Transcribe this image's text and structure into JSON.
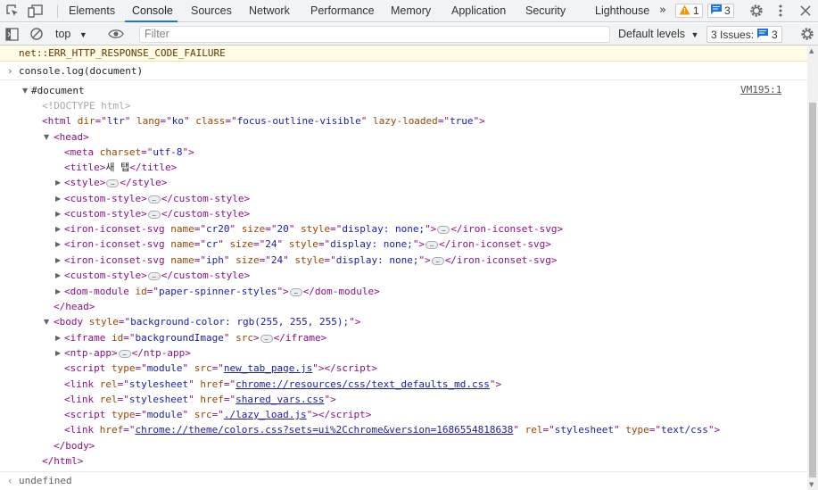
{
  "tabs": [
    {
      "label": "Elements",
      "active": false
    },
    {
      "label": "Console",
      "active": true
    },
    {
      "label": "Sources",
      "active": false
    },
    {
      "label": "Network",
      "active": false
    },
    {
      "label": "Performance",
      "active": false
    },
    {
      "label": "Memory",
      "active": false
    },
    {
      "label": "Application",
      "active": false
    },
    {
      "label": "Security",
      "active": false
    },
    {
      "label": "Lighthouse",
      "active": false
    }
  ],
  "more_tabs": "»",
  "warnings_count": "1",
  "messages_count": "3",
  "toolbar": {
    "context": "top",
    "filter_placeholder": "Filter",
    "levels": "Default levels",
    "issues_label": "3 Issues:",
    "issues_count": "3"
  },
  "error_text": "net::ERR_HTTP_RESPONSE_CODE_FAILURE",
  "command": "console.log(document)",
  "source_link": "VM195:1",
  "result": {
    "root": "#document",
    "doctype": "<!DOCTYPE html>",
    "lines": {
      "html_open": {
        "tag": "html",
        "attrs": [
          [
            "dir",
            "ltr"
          ],
          [
            "lang",
            "ko"
          ],
          [
            "class",
            "focus-outline-visible"
          ],
          [
            "lazy-loaded",
            "true"
          ]
        ]
      },
      "head_open": "head",
      "meta": {
        "tag": "meta",
        "attrs": [
          [
            "charset",
            "utf-8"
          ]
        ]
      },
      "title_text": "새 탭",
      "style": "style",
      "custom_style": "custom-style",
      "iron1": {
        "tag": "iron-iconset-svg",
        "attrs": [
          [
            "name",
            "cr20"
          ],
          [
            "size",
            "20"
          ],
          [
            "style",
            "display: none;"
          ]
        ]
      },
      "iron2": {
        "tag": "iron-iconset-svg",
        "attrs": [
          [
            "name",
            "cr"
          ],
          [
            "size",
            "24"
          ],
          [
            "style",
            "display: none;"
          ]
        ]
      },
      "iron3": {
        "tag": "iron-iconset-svg",
        "attrs": [
          [
            "name",
            "iph"
          ],
          [
            "size",
            "24"
          ],
          [
            "style",
            "display: none;"
          ]
        ]
      },
      "dom_module": {
        "tag": "dom-module",
        "attrs": [
          [
            "id",
            "paper-spinner-styles"
          ]
        ]
      },
      "body": {
        "tag": "body",
        "attrs": [
          [
            "style",
            "background-color: rgb(255, 255, 255);"
          ]
        ]
      },
      "iframe": {
        "tag": "iframe",
        "attrs": [
          [
            "id",
            "backgroundImage"
          ]
        ],
        "extra_attr": "src"
      },
      "ntp_app": "ntp-app",
      "script1": {
        "type": "module",
        "src": "new_tab_page.js"
      },
      "link1": {
        "rel": "stylesheet",
        "href": "chrome://resources/css/text_defaults_md.css"
      },
      "link2": {
        "rel": "stylesheet",
        "href": "shared_vars.css"
      },
      "script2": {
        "type": "module",
        "src": "./lazy_load.js"
      },
      "link3": {
        "href": "chrome://theme/colors.css?sets=ui%2Cchrome&version=1686554818638",
        "rel": "stylesheet",
        "type": "text/css"
      }
    }
  },
  "undefined_text": "undefined",
  "colors": {
    "accent": "#1a73e8",
    "tag": "#881280",
    "attr": "#994500",
    "value": "#1a1aa6",
    "warning_bg": "#fffbe5"
  }
}
